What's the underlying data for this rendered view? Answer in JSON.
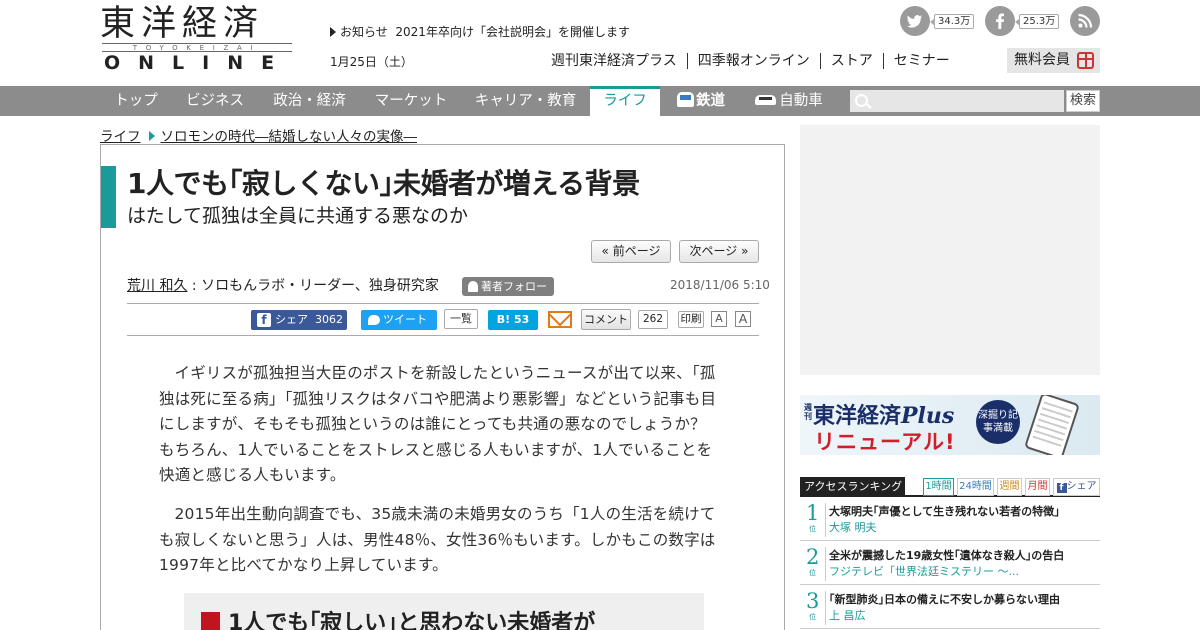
{
  "header": {
    "logo_kanji": "東洋経済",
    "logo_romaji": "TOYOKEIZAI",
    "logo_online": "ONLINE",
    "notice_label": "お知らせ",
    "notice_text": "2021年卒向け「会社説明会」を開催します",
    "date": "1月25日（土）",
    "twitter_count": "34.3万",
    "facebook_count": "25.3万",
    "top_nav": [
      "週刊東洋経済プラス",
      "四季報オンライン",
      "ストア",
      "セミナー"
    ],
    "member_button": "無料会員"
  },
  "navbar": {
    "items": [
      "トップ",
      "ビジネス",
      "政治・経済",
      "マーケット",
      "キャリア・教育",
      "ライフ",
      "鉄道",
      "自動車"
    ],
    "active": "ライフ",
    "search_placeholder": "",
    "search_button": "検索",
    "accent_color": "#1a9a9a"
  },
  "breadcrumb": {
    "section": "ライフ",
    "series": "ソロモンの時代―結婚しない人々の実像―"
  },
  "article": {
    "title": "1人でも｢寂しくない｣未婚者が増える背景",
    "subtitle": "はたして孤独は全員に共通する悪なのか",
    "prev_page": "« 前ページ",
    "next_page": "次ページ »",
    "author_name": "荒川 和久",
    "author_role": " : ソロもんラボ・リーダー、独身研究家",
    "follow_button": "著者フォロー",
    "published": "2018/11/06 5:10",
    "share": {
      "facebook_label": "シェア",
      "facebook_count": "3062",
      "tweet_label": "ツイート",
      "list_label": "一覧",
      "hatena_label": "B!",
      "hatena_count": "53",
      "comment_label": "コメント",
      "comment_count": "262",
      "print_label": "印刷",
      "font_small": "A",
      "font_large": "A"
    },
    "paragraphs": [
      "イギリスが孤独担当大臣のポストを新設したというニュースが出て以来、「孤独は死に至る病」「孤独リスクはタバコや肥満より悪影響」などという記事も目にしますが、そもそも孤独というのは誰にとっても共通の悪なのでしょうか？　もちろん、1人でいることをストレスと感じる人もいますが、1人でいることを快適と感じる人もいます。",
      "2015年出生動向調査でも、35歳未満の未婚男女のうち「1人の生活を続けても寂しくないと思う」人は、男性48％、女性36％もいます。しかもこの数字は1997年と比べてかなり上昇しています。"
    ],
    "figure_heading": "1人でも｢寂しい｣と思わない未婚者が"
  },
  "sidebar": {
    "banner": {
      "weekly": "週刊",
      "brand": "東洋経済",
      "brand_plus": "Plus",
      "renewal": "リニューアル!",
      "badge": "深掘り記事満載"
    },
    "ranking": {
      "title": "アクセスランキング",
      "tabs": [
        "1時間",
        "24時間",
        "週間",
        "月間",
        "シェア"
      ],
      "items": [
        {
          "rank": "1",
          "unit": "位",
          "title": "大塚明夫｢声優として生き残れない若者の特徴｣",
          "sub": "大塚 明夫"
        },
        {
          "rank": "2",
          "unit": "位",
          "title": "全米が震撼した19歳女性｢遺体なき殺人｣の告白",
          "sub": "フジテレビ「世界法廷ミステリー ～..."
        },
        {
          "rank": "3",
          "unit": "位",
          "title": "｢新型肺炎｣日本の備えに不安しか募らない理由",
          "sub": "上 昌広"
        }
      ]
    }
  }
}
